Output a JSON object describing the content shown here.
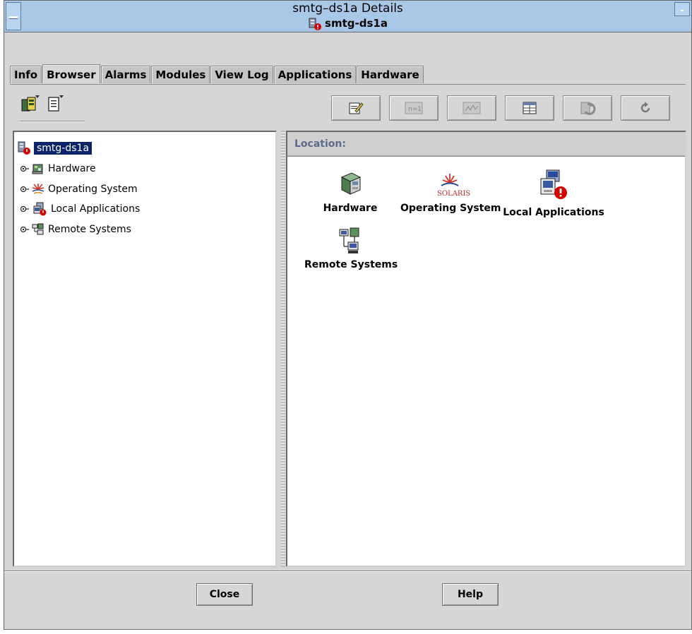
{
  "window": {
    "title": "smtg–ds1a Details",
    "host_heading": "smtg-ds1a"
  },
  "tabs": [
    {
      "label": "Info"
    },
    {
      "label": "Browser",
      "active": true
    },
    {
      "label": "Alarms"
    },
    {
      "label": "Modules"
    },
    {
      "label": "View Log"
    },
    {
      "label": "Applications"
    },
    {
      "label": "Hardware"
    }
  ],
  "toolbar": {
    "left_icons": [
      "host-details-icon",
      "property-sheet-icon"
    ],
    "right_buttons": [
      "edit-icon",
      "attribute-editor-icon",
      "graph-icon",
      "table-icon",
      "refresh-icon",
      "reload-icon"
    ]
  },
  "tree": {
    "root": {
      "label": "smtg-ds1a",
      "selected": true,
      "alarm": true
    },
    "children": [
      {
        "label": "Hardware",
        "icon": "hardware-icon"
      },
      {
        "label": "Operating System",
        "icon": "solaris-icon"
      },
      {
        "label": "Local Applications",
        "icon": "local-apps-icon",
        "alarm": true
      },
      {
        "label": "Remote Systems",
        "icon": "remote-systems-icon"
      }
    ]
  },
  "content": {
    "location_label": "Location:",
    "solaris_text": "SOLARIS",
    "items": [
      {
        "label": "Hardware"
      },
      {
        "label": "Operating System"
      },
      {
        "label": "Local Applications"
      },
      {
        "label": "Remote Systems"
      }
    ]
  },
  "buttons": {
    "close": "Close",
    "help": "Help"
  },
  "colors": {
    "titlebar": "#a9c8e8",
    "selection": "#0a246a",
    "alarm": "#d40000",
    "location_text": "#5b6b8c"
  }
}
